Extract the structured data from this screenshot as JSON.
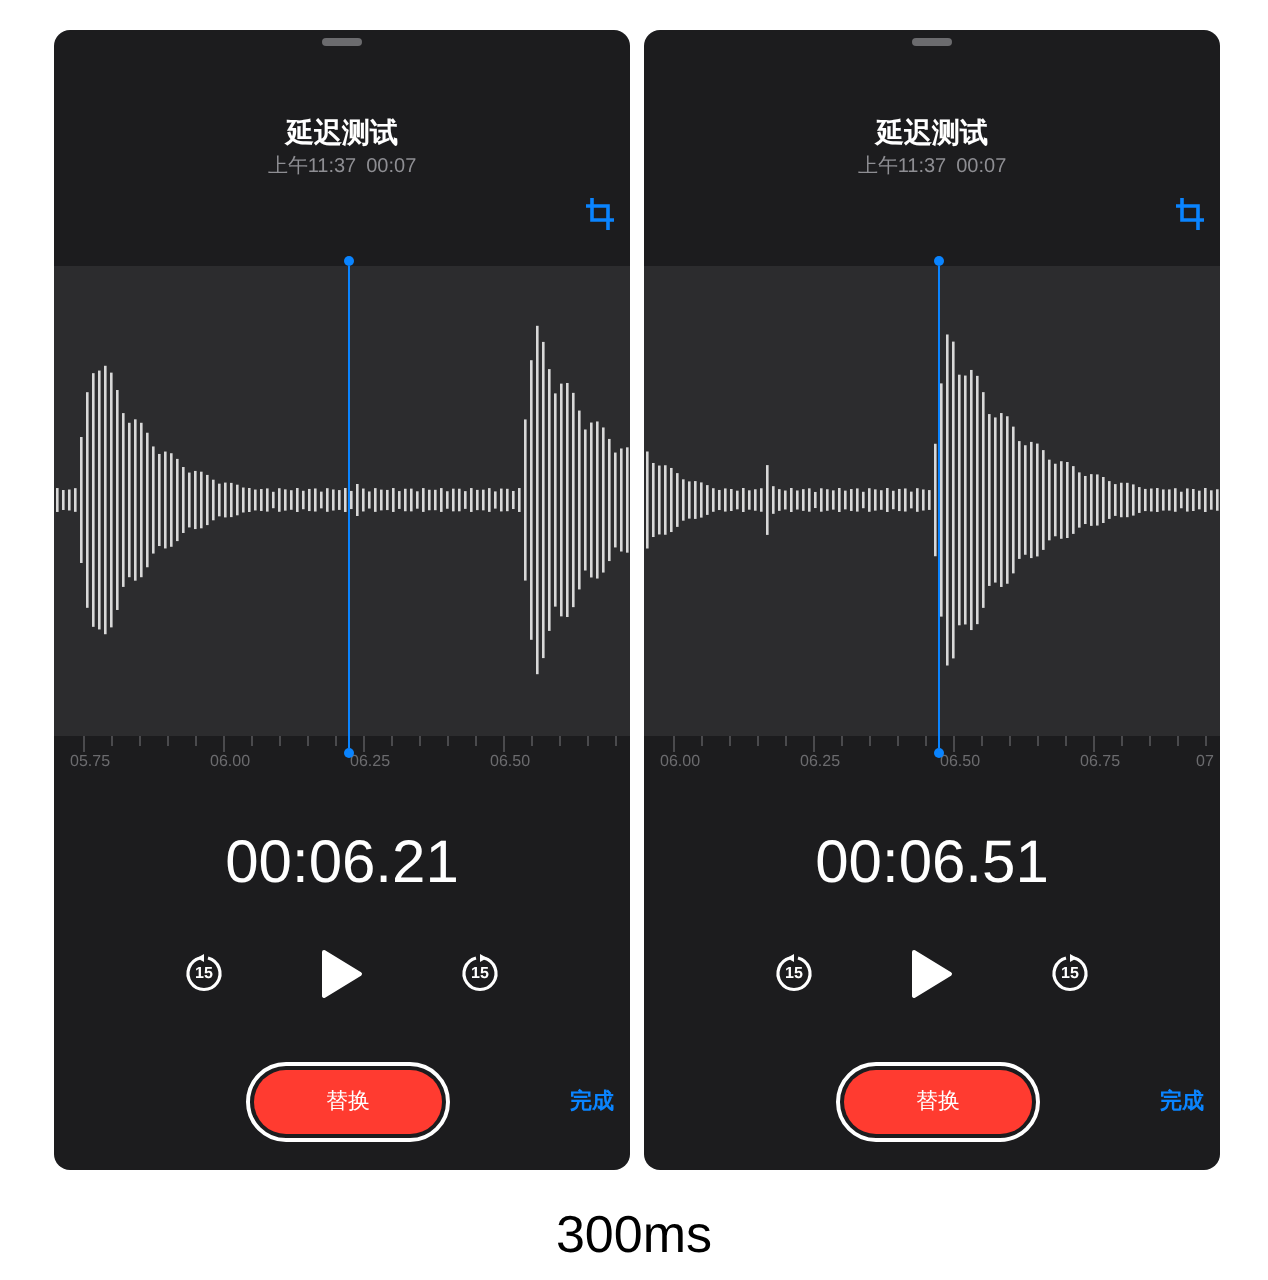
{
  "panels": [
    {
      "title": "延迟测试",
      "date": "上午11:37",
      "duration": "00:07",
      "ticks": [
        "05.75",
        "06.00",
        "06.25",
        "06.50"
      ],
      "time": "00:06.21",
      "skip_back": "15",
      "skip_forward": "15",
      "replace_button": "替换",
      "done_button": "完成"
    },
    {
      "title": "延迟测试",
      "date": "上午11:37",
      "duration": "00:07",
      "ticks": [
        "06.00",
        "06.25",
        "06.50",
        "06.75",
        "07"
      ],
      "time": "00:06.51",
      "skip_back": "15",
      "skip_forward": "15",
      "replace_button": "替换",
      "done_button": "完成"
    }
  ],
  "caption": "300ms"
}
